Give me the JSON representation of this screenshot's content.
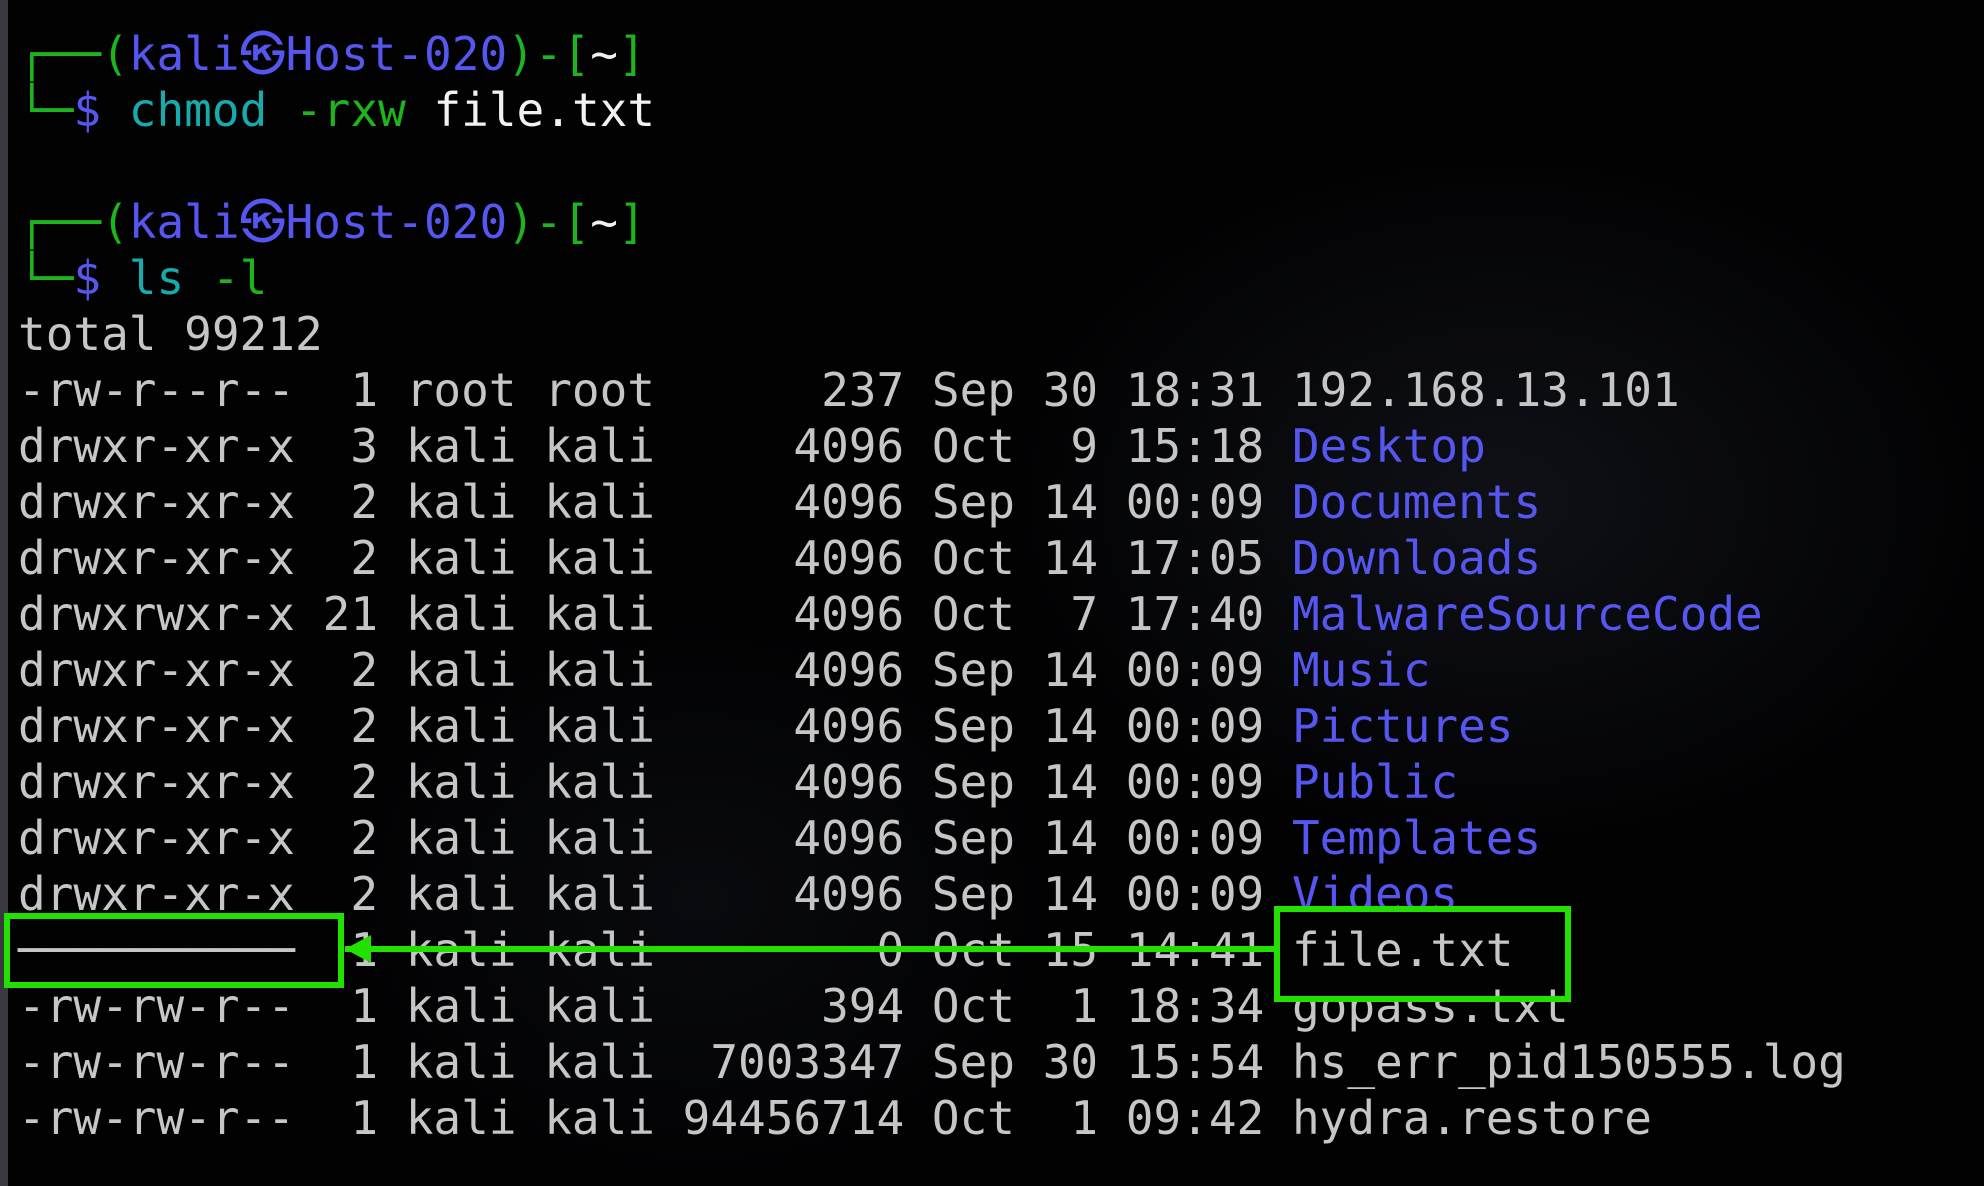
{
  "prompts": [
    {
      "corner_top": "┌──",
      "open": "(",
      "user": "kali",
      "at": "㉿",
      "host": "Host-020",
      "close": ")-[",
      "dir": "~",
      "end": "]",
      "corner_bottom": "└─",
      "dollar": "$",
      "command": "chmod",
      "flag": "-rxw",
      "arg": "file.txt"
    },
    {
      "corner_top": "┌──",
      "open": "(",
      "user": "kali",
      "at": "㉿",
      "host": "Host-020",
      "close": ")-[",
      "dir": "~",
      "end": "]",
      "corner_bottom": "└─",
      "dollar": "$",
      "command": "ls",
      "flag": "-l",
      "arg": ""
    }
  ],
  "total_line": "total 99212",
  "rows": [
    {
      "perms": "-rw-r--r--",
      "links": "1",
      "owner": "root",
      "group": "root",
      "size": "237",
      "month": "Sep",
      "day": "30",
      "time": "18:31",
      "name": "192.168.13.101",
      "dir": false
    },
    {
      "perms": "drwxr-xr-x",
      "links": "3",
      "owner": "kali",
      "group": "kali",
      "size": "4096",
      "month": "Oct",
      "day": "9",
      "time": "15:18",
      "name": "Desktop",
      "dir": true
    },
    {
      "perms": "drwxr-xr-x",
      "links": "2",
      "owner": "kali",
      "group": "kali",
      "size": "4096",
      "month": "Sep",
      "day": "14",
      "time": "00:09",
      "name": "Documents",
      "dir": true
    },
    {
      "perms": "drwxr-xr-x",
      "links": "2",
      "owner": "kali",
      "group": "kali",
      "size": "4096",
      "month": "Oct",
      "day": "14",
      "time": "17:05",
      "name": "Downloads",
      "dir": true
    },
    {
      "perms": "drwxrwxr-x",
      "links": "21",
      "owner": "kali",
      "group": "kali",
      "size": "4096",
      "month": "Oct",
      "day": "7",
      "time": "17:40",
      "name": "MalwareSourceCode",
      "dir": true
    },
    {
      "perms": "drwxr-xr-x",
      "links": "2",
      "owner": "kali",
      "group": "kali",
      "size": "4096",
      "month": "Sep",
      "day": "14",
      "time": "00:09",
      "name": "Music",
      "dir": true
    },
    {
      "perms": "drwxr-xr-x",
      "links": "2",
      "owner": "kali",
      "group": "kali",
      "size": "4096",
      "month": "Sep",
      "day": "14",
      "time": "00:09",
      "name": "Pictures",
      "dir": true
    },
    {
      "perms": "drwxr-xr-x",
      "links": "2",
      "owner": "kali",
      "group": "kali",
      "size": "4096",
      "month": "Sep",
      "day": "14",
      "time": "00:09",
      "name": "Public",
      "dir": true
    },
    {
      "perms": "drwxr-xr-x",
      "links": "2",
      "owner": "kali",
      "group": "kali",
      "size": "4096",
      "month": "Sep",
      "day": "14",
      "time": "00:09",
      "name": "Templates",
      "dir": true
    },
    {
      "perms": "drwxr-xr-x",
      "links": "2",
      "owner": "kali",
      "group": "kali",
      "size": "4096",
      "month": "Sep",
      "day": "14",
      "time": "00:09",
      "name": "Videos",
      "dir": true
    },
    {
      "perms": "──────────",
      "links": "1",
      "owner": "kali",
      "group": "kali",
      "size": "0",
      "month": "Oct",
      "day": "15",
      "time": "14:41",
      "name": "file.txt",
      "dir": false
    },
    {
      "perms": "-rw-rw-r--",
      "links": "1",
      "owner": "kali",
      "group": "kali",
      "size": "394",
      "month": "Oct",
      "day": "1",
      "time": "18:34",
      "name": "gopass.txt",
      "dir": false
    },
    {
      "perms": "-rw-rw-r--",
      "links": "1",
      "owner": "kali",
      "group": "kali",
      "size": "7003347",
      "month": "Sep",
      "day": "30",
      "time": "15:54",
      "name": "hs_err_pid150555.log",
      "dir": false
    },
    {
      "perms": "-rw-rw-r--",
      "links": "1",
      "owner": "kali",
      "group": "kali",
      "size": "94456714",
      "month": "Oct",
      "day": "1",
      "time": "09:42",
      "name": "hydra.restore",
      "dir": false
    }
  ],
  "colors": {
    "prompt_green": "#1db41d",
    "prompt_blue": "#5656f0",
    "command_cyan": "#17abab",
    "annotation_green": "#22e000",
    "text_gray": "#c6c6c6"
  }
}
